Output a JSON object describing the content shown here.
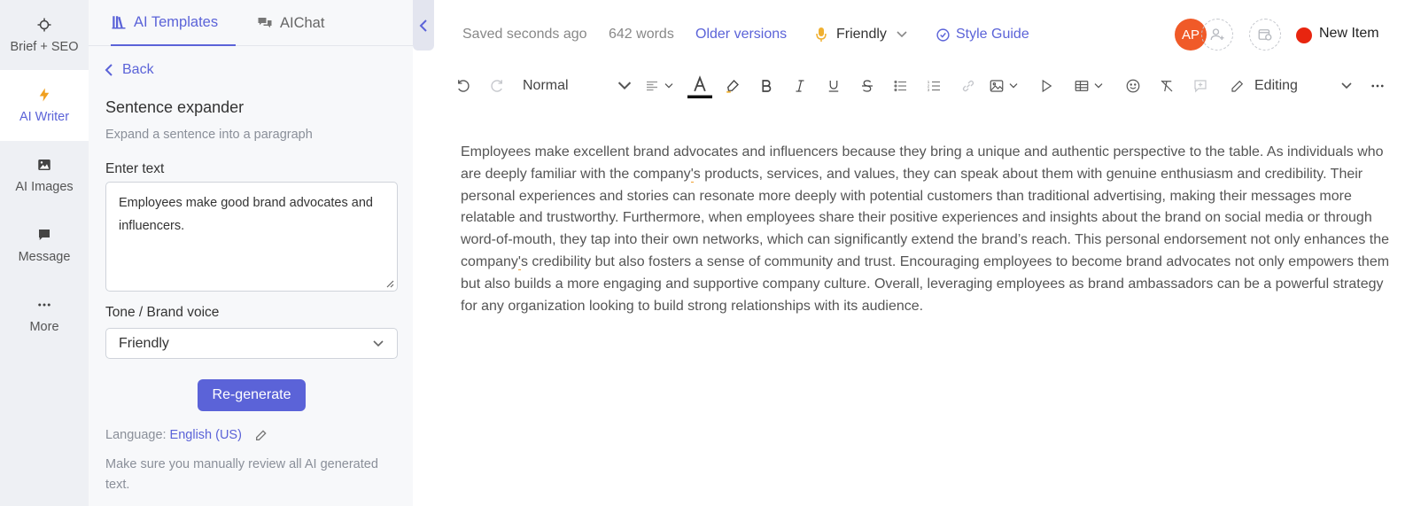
{
  "rail": {
    "items": [
      {
        "label": "Brief + SEO",
        "icon": "crosshair-icon"
      },
      {
        "label": "AI Writer",
        "icon": "lightning-icon"
      },
      {
        "label": "AI Images",
        "icon": "image-icon"
      },
      {
        "label": "Message",
        "icon": "message-icon"
      },
      {
        "label": "More",
        "icon": "more-dots-icon"
      }
    ]
  },
  "panel": {
    "tabs": [
      {
        "label": "AI Templates",
        "icon": "library-icon"
      },
      {
        "label": "AIChat",
        "icon": "chat-bubbles-icon"
      }
    ],
    "back_label": "Back",
    "title": "Sentence expander",
    "subtitle": "Expand a sentence into a paragraph",
    "input_label": "Enter text",
    "input_value": "Employees make good brand advocates and influencers.",
    "tone_label": "Tone / Brand voice",
    "tone_value": "Friendly",
    "regenerate_label": "Re-generate",
    "language_label": "Language:",
    "language_value": "English (US)",
    "note": "Make sure you manually review all AI generated text."
  },
  "topbar": {
    "saved": "Saved seconds ago",
    "word_count": "642 words",
    "older_versions": "Older versions",
    "tone": "Friendly",
    "style_guide": "Style Guide",
    "avatar_initials": "AP",
    "status_label": "New Item",
    "status_color": "#e8250f",
    "accent_color": "#5b63d8"
  },
  "toolbar": {
    "paragraph_style": "Normal",
    "mode": "Editing"
  },
  "editor": {
    "p1": "Employees make excellent brand advocates and influencers because they bring a unique and authentic perspective to the table. As individuals who are deeply familiar with the company",
    "p2": "s products, services, and values, they can speak about them with genuine enthusiasm and credibility. Their personal experiences and stories can resonate more deeply with potential customers than traditional advertising, making their messages more relatable and trustworthy. Furthermore, when employees share their positive experiences and insights about the brand on social media or through word-of-mouth, they tap into their own networks, which can significantly extend the brand’s reach. This personal endorsement not only enhances the company",
    "p3": "s credibility but also fosters a sense of community and trust. Encouraging employees to become brand advocates not only empowers them but also builds a more engaging and supportive company culture. Overall, leveraging employees as brand ambassadors can be a powerful strategy for any organization looking to build strong relationships with its audience.",
    "apostrophe": "'"
  }
}
